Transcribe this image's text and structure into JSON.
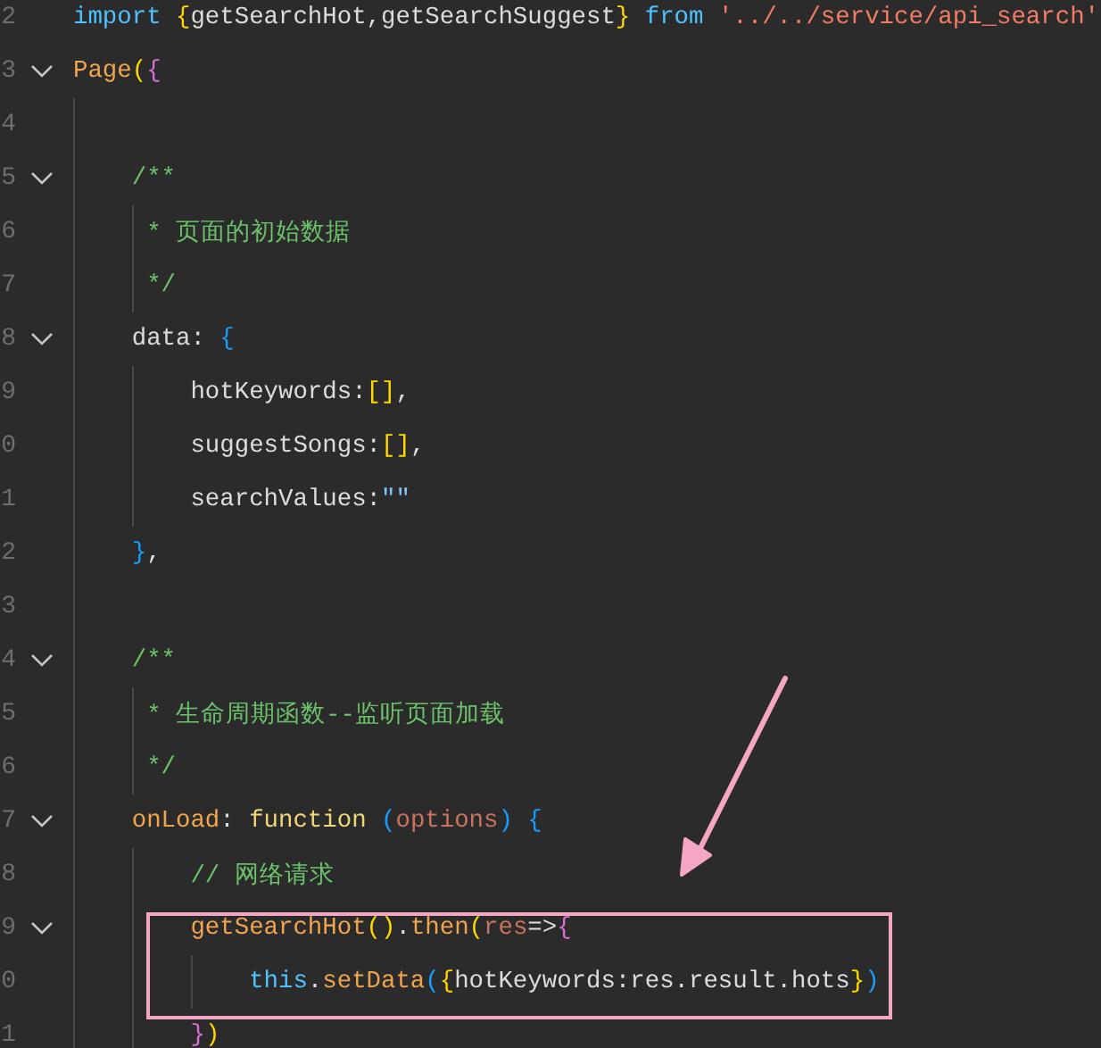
{
  "editor": {
    "lines": [
      {
        "number": "2",
        "foldable": false,
        "highlight": false,
        "tokens": [
          {
            "text": "import ",
            "color": "#4fc1ff"
          },
          {
            "text": "{",
            "color": "#ffd700"
          },
          {
            "text": "getSearchHot,getSearchSuggest",
            "color": "#dcdcdc"
          },
          {
            "text": "} ",
            "color": "#ffd700"
          },
          {
            "text": "from ",
            "color": "#4fc1ff"
          },
          {
            "text": "'../../service/api_search'",
            "color": "#f27c66"
          }
        ]
      },
      {
        "number": "3",
        "foldable": true,
        "highlight": false,
        "tokens": [
          {
            "text": "Page",
            "color": "#f0a44e"
          },
          {
            "text": "(",
            "color": "#ffd700"
          },
          {
            "text": "{",
            "color": "#da70d6"
          }
        ]
      },
      {
        "number": "4",
        "foldable": false,
        "highlight": false
      },
      {
        "number": "5",
        "foldable": true,
        "highlight": false,
        "tokens": [
          {
            "text": "    /**",
            "color": "#6cc26a"
          }
        ]
      },
      {
        "number": "6",
        "foldable": false,
        "highlight": false,
        "tokens": [
          {
            "text": "     * 页面的初始数据",
            "color": "#6cc26a"
          }
        ]
      },
      {
        "number": "7",
        "foldable": false,
        "highlight": false,
        "tokens": [
          {
            "text": "     */",
            "color": "#6cc26a"
          }
        ]
      },
      {
        "number": "8",
        "foldable": true,
        "highlight": false,
        "tokens": [
          {
            "text": "    data: ",
            "color": "#dcdcdc"
          },
          {
            "text": "{",
            "color": "#179fff"
          }
        ]
      },
      {
        "number": "9",
        "foldable": false,
        "highlight": false,
        "tokens": [
          {
            "text": "        hotKeywords:",
            "color": "#dcdcdc"
          },
          {
            "text": "[]",
            "color": "#ffd700"
          },
          {
            "text": ",",
            "color": "#dcdcdc"
          }
        ]
      },
      {
        "number": "0",
        "foldable": false,
        "highlight": false,
        "tokens": [
          {
            "text": "        suggestSongs:",
            "color": "#dcdcdc"
          },
          {
            "text": "[]",
            "color": "#ffd700"
          },
          {
            "text": ",",
            "color": "#dcdcdc"
          }
        ]
      },
      {
        "number": "1",
        "foldable": false,
        "highlight": false,
        "tokens": [
          {
            "text": "        searchValues:",
            "color": "#dcdcdc"
          },
          {
            "text": "\"\"",
            "color": "#7fc8f8"
          }
        ]
      },
      {
        "number": "2",
        "foldable": false,
        "highlight": false,
        "tokens": [
          {
            "text": "    }",
            "color": "#179fff"
          },
          {
            "text": ",",
            "color": "#dcdcdc"
          }
        ]
      },
      {
        "number": "3",
        "foldable": false,
        "highlight": false
      },
      {
        "number": "4",
        "foldable": true,
        "highlight": false,
        "tokens": [
          {
            "text": "    /**",
            "color": "#6cc26a"
          }
        ]
      },
      {
        "number": "5",
        "foldable": false,
        "highlight": false,
        "tokens": [
          {
            "text": "     * 生命周期函数--监听页面加载",
            "color": "#6cc26a"
          }
        ]
      },
      {
        "number": "6",
        "foldable": false,
        "highlight": false,
        "tokens": [
          {
            "text": "     */",
            "color": "#6cc26a"
          }
        ]
      },
      {
        "number": "7",
        "foldable": true,
        "highlight": false,
        "tokens": [
          {
            "text": "    onLoad",
            "color": "#f0a44e"
          },
          {
            "text": ": ",
            "color": "#dcdcdc"
          },
          {
            "text": "function ",
            "color": "#f2d479"
          },
          {
            "text": "(",
            "color": "#179fff"
          },
          {
            "text": "options",
            "color": "#c9735f"
          },
          {
            "text": ") ",
            "color": "#179fff"
          },
          {
            "text": "{",
            "color": "#179fff"
          }
        ]
      },
      {
        "number": "8",
        "foldable": false,
        "highlight": false,
        "tokens": [
          {
            "text": "        // 网络请求",
            "color": "#6cc26a"
          }
        ]
      },
      {
        "number": "9",
        "foldable": true,
        "highlight": true,
        "tokens": [
          {
            "text": "        getSearchHot",
            "color": "#f0a44e"
          },
          {
            "text": "()",
            "color": "#ffd700"
          },
          {
            "text": ".",
            "color": "#dcdcdc"
          },
          {
            "text": "then",
            "color": "#f0a44e"
          },
          {
            "text": "(",
            "color": "#ffd700"
          },
          {
            "text": "res",
            "color": "#c9735f"
          },
          {
            "text": "=>",
            "color": "#dcdcdc"
          },
          {
            "text": "{",
            "color": "#da70d6"
          }
        ]
      },
      {
        "number": "0",
        "foldable": false,
        "highlight": true,
        "tokens": [
          {
            "text": "            this",
            "color": "#4fc1ff"
          },
          {
            "text": ".",
            "color": "#dcdcdc"
          },
          {
            "text": "setData",
            "color": "#f0a44e"
          },
          {
            "text": "(",
            "color": "#179fff"
          },
          {
            "text": "{",
            "color": "#ffd700"
          },
          {
            "text": "hotKeywords:res.result.hots",
            "color": "#dcdcdc"
          },
          {
            "text": "}",
            "color": "#ffd700"
          },
          {
            "text": ")",
            "color": "#179fff"
          }
        ]
      },
      {
        "number": "1",
        "foldable": false,
        "highlight": false,
        "tokens": [
          {
            "text": "        }",
            "color": "#da70d6"
          },
          {
            "text": ")",
            "color": "#ffd700"
          }
        ]
      }
    ]
  }
}
